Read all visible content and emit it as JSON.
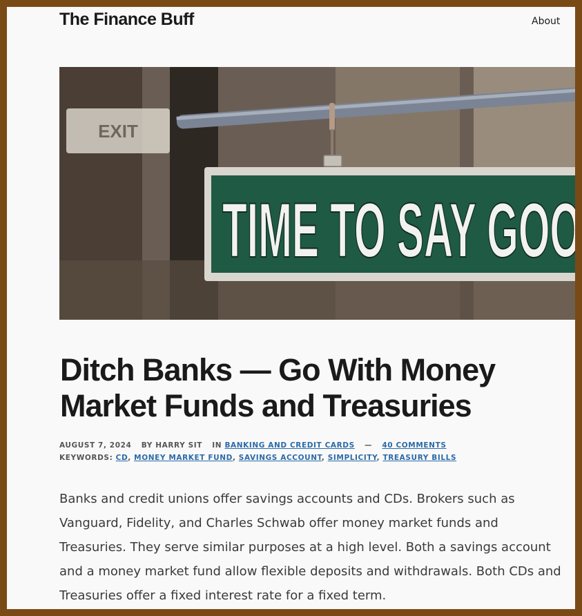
{
  "header": {
    "site_title": "The Finance Buff",
    "nav": {
      "about": "About"
    }
  },
  "hero": {
    "sign_text": "TIME TO SAY GOO",
    "background_sign_text": "EXIT"
  },
  "article": {
    "title": "Ditch Banks — Go With Money Market Funds and Treasuries",
    "meta": {
      "date": "AUGUST 7, 2024",
      "by_label": "BY",
      "author": "HARRY SIT",
      "in_label": "IN",
      "category": "BANKING AND CREDIT CARDS",
      "separator": "—",
      "comments": "40 COMMENTS",
      "keywords_label": "KEYWORDS:",
      "keywords": [
        "CD",
        "MONEY MARKET FUND",
        "SAVINGS ACCOUNT",
        "SIMPLICITY",
        "TREASURY BILLS"
      ]
    },
    "intro": "Banks and credit unions offer savings accounts and CDs. Brokers such as Vanguard, Fidelity, and Charles Schwab offer money market funds and Treasuries. They serve similar purposes at a high level. Both a savings account and a money market fund allow flexible deposits and withdrawals. Both CDs and Treasuries offer a fixed interest rate for a fixed term."
  },
  "colors": {
    "frame_border": "#7a4a16",
    "page_bg": "#f9f9f9",
    "link": "#2b6aa8",
    "sign_green": "#1f5a45"
  }
}
